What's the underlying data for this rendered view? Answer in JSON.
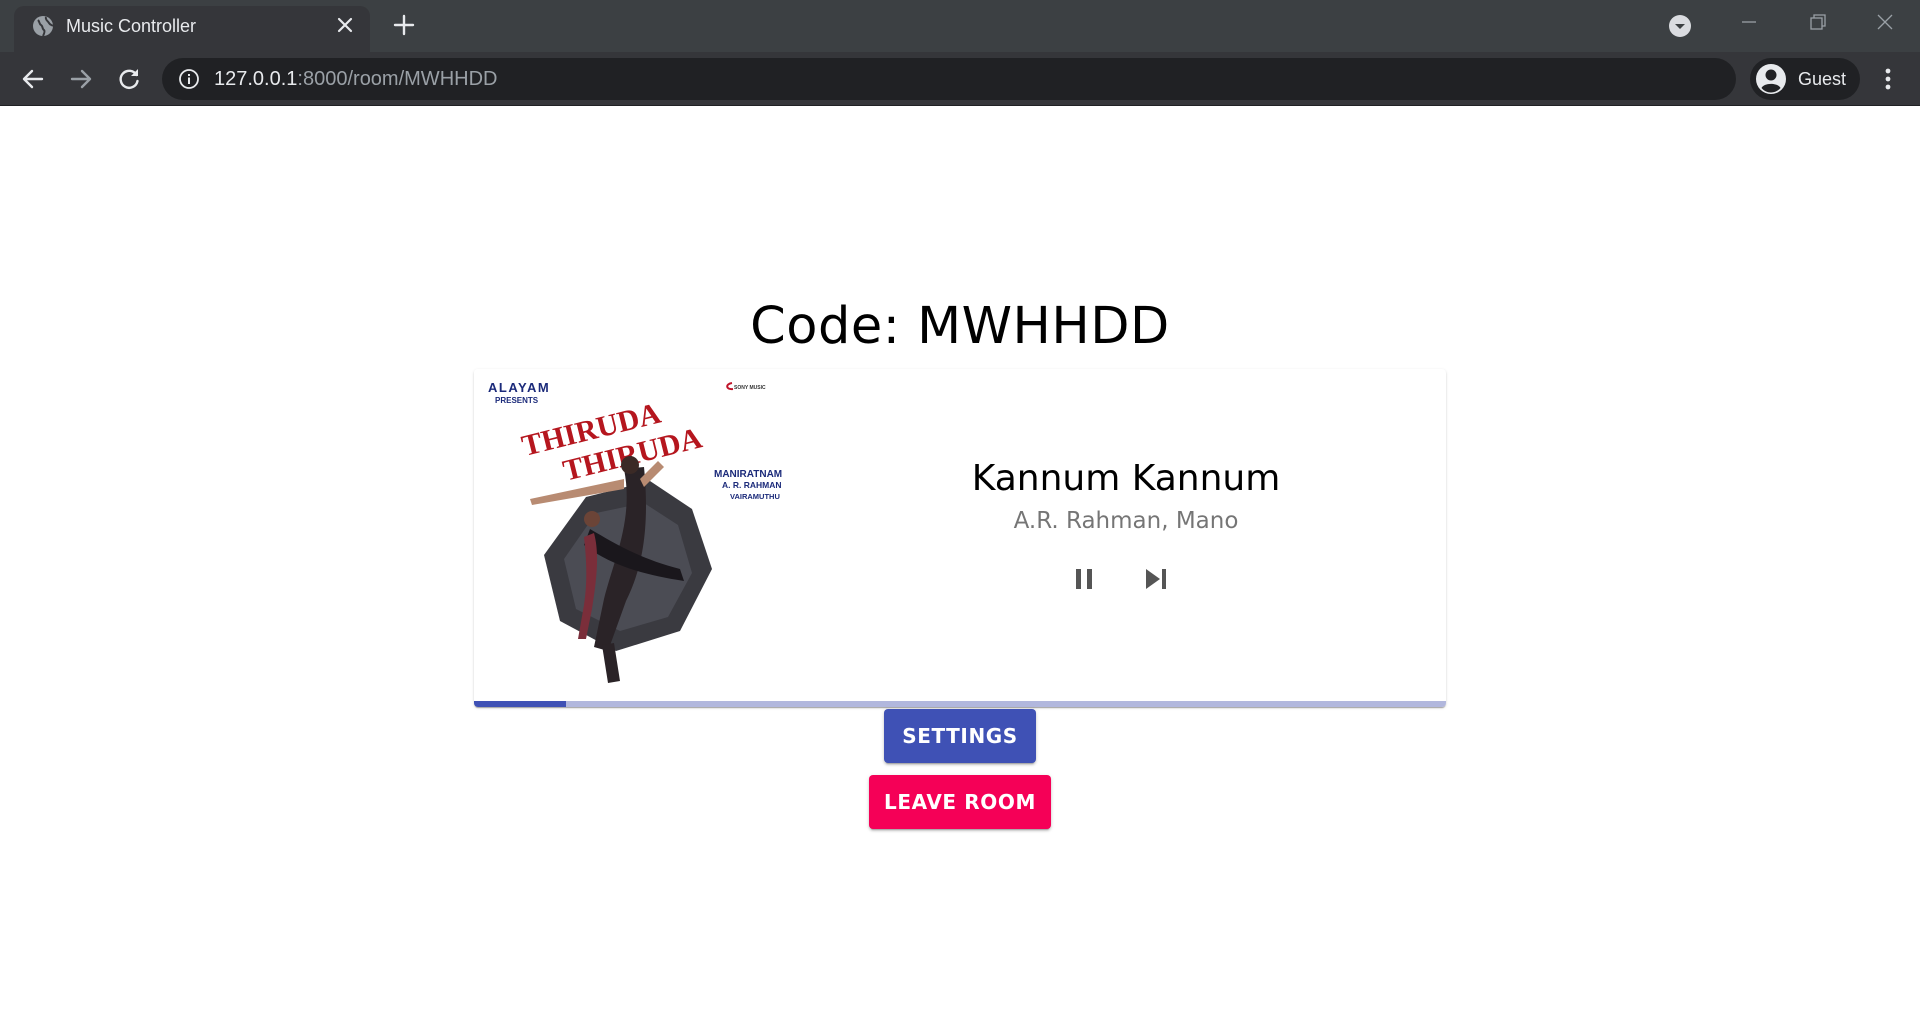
{
  "browser": {
    "tab_title": "Music Controller",
    "url_host": "127.0.0.1",
    "url_rest": ":8000/room/MWHHDD",
    "profile_name": "Guest",
    "icons": {
      "tab": "globe-icon",
      "tab_close": "close-icon",
      "new_tab": "plus-icon",
      "tab_search": "chevron-down-icon",
      "back": "arrow-left-icon",
      "forward": "arrow-right-icon",
      "reload": "reload-icon",
      "site_info": "info-icon",
      "profile": "account-circle-icon",
      "menu": "more-vert-icon"
    }
  },
  "room": {
    "code_label": "Code: MWHHDD"
  },
  "player": {
    "title": "Kannum Kannum",
    "artist": "A.R. Rahman, Mano",
    "progress_fraction": 0.095,
    "album_art": {
      "text_top": "ALAYAM",
      "text_presents": "PRESENTS",
      "text_title_1": "THIRUDA",
      "text_title_2": "THIRUDA",
      "text_label": "SONY MUSIC",
      "text_credit_1": "MANIRATNAM",
      "text_credit_2": "A. R. RAHMAN",
      "text_credit_3": "VAIRAMUTHU"
    },
    "icons": {
      "pause": "pause-icon",
      "skip": "skip-next-icon"
    }
  },
  "actions": {
    "settings_label": "SETTINGS",
    "leave_label": "LEAVE ROOM"
  },
  "colors": {
    "primary": "#3f51b5",
    "secondary": "#f50057",
    "progress_track": "#b1b7dd"
  }
}
